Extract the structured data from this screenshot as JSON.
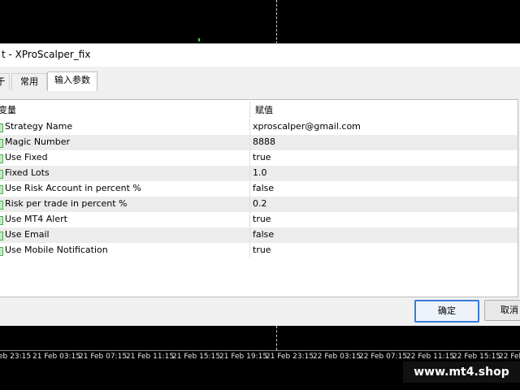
{
  "dialog": {
    "title": "t - XProScalper_fix",
    "tabs": [
      {
        "label": "于",
        "active": false
      },
      {
        "label": "常用",
        "active": false
      },
      {
        "label": "输入参数",
        "active": true
      }
    ],
    "table": {
      "headers": {
        "variable": "变量",
        "value": "赋值"
      },
      "rows": [
        {
          "name": "Strategy Name",
          "value": "xproscalper@gmail.com"
        },
        {
          "name": "Magic Number",
          "value": "8888"
        },
        {
          "name": "Use Fixed",
          "value": "true"
        },
        {
          "name": "Fixed Lots",
          "value": "1.0"
        },
        {
          "name": "Use Risk Account in percent %",
          "value": "false"
        },
        {
          "name": "Risk per trade in percent %",
          "value": "0.2"
        },
        {
          "name": "Use MT4 Alert",
          "value": "true"
        },
        {
          "name": "Use Email",
          "value": "false"
        },
        {
          "name": "Use Mobile Notification",
          "value": "true"
        }
      ]
    },
    "buttons": {
      "ok": "确定",
      "cancel": "取消"
    }
  },
  "chart": {
    "time_labels": [
      "eb 23:15",
      "21 Feb 03:15",
      "21 Feb 07:15",
      "21 Feb 11:15",
      "21 Feb 15:15",
      "21 Feb 19:15",
      "21 Feb 23:15",
      "22 Feb 03:15",
      "22 Feb 07:15",
      "22 Feb 11:15",
      "22 Feb 15:15",
      "22 Feb"
    ],
    "watermark": "www.mt4.shop"
  }
}
